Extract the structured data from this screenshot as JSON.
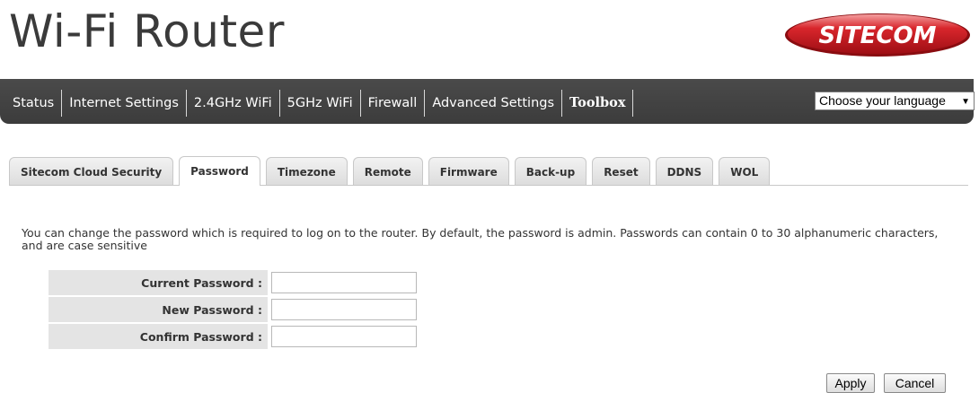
{
  "header": {
    "title": "Wi-Fi Router",
    "logo_text": "SITECOM"
  },
  "nav": {
    "items": [
      {
        "label": "Status"
      },
      {
        "label": "Internet Settings"
      },
      {
        "label": "2.4GHz WiFi"
      },
      {
        "label": "5GHz WiFi"
      },
      {
        "label": "Firewall"
      },
      {
        "label": "Advanced Settings"
      },
      {
        "label": "Toolbox",
        "active": true
      }
    ],
    "language_select": "Choose your language"
  },
  "tabs": [
    {
      "label": "Sitecom Cloud Security"
    },
    {
      "label": "Password",
      "active": true
    },
    {
      "label": "Timezone"
    },
    {
      "label": "Remote"
    },
    {
      "label": "Firmware"
    },
    {
      "label": "Back-up"
    },
    {
      "label": "Reset"
    },
    {
      "label": "DDNS"
    },
    {
      "label": "WOL"
    }
  ],
  "main": {
    "description": "You can change the password which is required to log on to the router. By default, the password is admin. Passwords can contain 0 to 30 alphanumeric characters, and are case sensitive",
    "fields": [
      {
        "label": "Current Password :",
        "value": ""
      },
      {
        "label": "New Password :",
        "value": ""
      },
      {
        "label": "Confirm Password :",
        "value": ""
      }
    ],
    "apply_label": "Apply",
    "cancel_label": "Cancel"
  },
  "colors": {
    "navbar": "#434343",
    "logo_red": "#c8141e",
    "label_bg": "#e4e4e4"
  }
}
